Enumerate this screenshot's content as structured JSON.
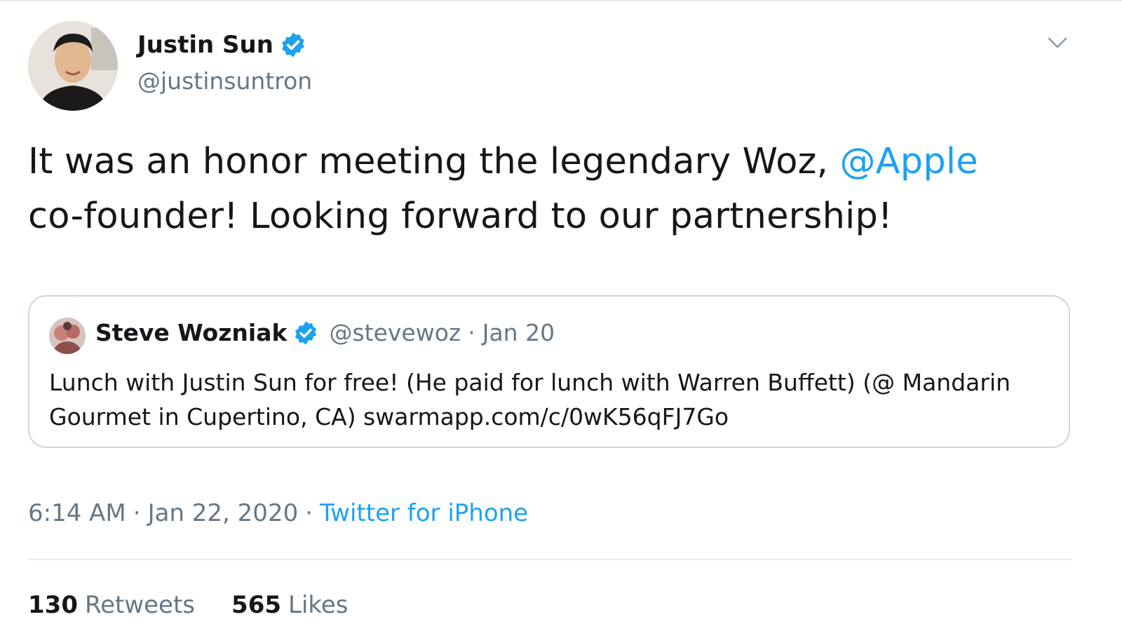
{
  "author": {
    "name": "Justin Sun",
    "handle": "@justinsuntron",
    "verified": true
  },
  "tweet": {
    "text_before_mention": "It was an honor meeting the legendary Woz, ",
    "mention": "@Apple",
    "text_after_mention": " co-founder! Looking forward to our partnership!"
  },
  "quoted_tweet": {
    "name": "Steve Wozniak",
    "handle": "@stevewoz",
    "separator": "·",
    "date": "Jan 20",
    "verified": true,
    "text": "Lunch with Justin Sun for free! (He paid for lunch with Warren Buffett) (@ Mandarin Gourmet in Cupertino, CA) swarmapp.com/c/0wK56qFJ7Go"
  },
  "meta": {
    "time": "6:14 AM",
    "separator": "·",
    "date": "Jan 22, 2020",
    "source": "Twitter for iPhone"
  },
  "stats": {
    "retweets_count": "130",
    "retweets_label": "Retweets",
    "likes_count": "565",
    "likes_label": "Likes"
  },
  "icons": {
    "verified": "verified-badge-icon",
    "caret": "chevron-down-icon"
  },
  "colors": {
    "accent": "#1da1f2",
    "secondary_text": "#657786",
    "primary_text": "#14171a",
    "border": "#ccd6dd"
  }
}
